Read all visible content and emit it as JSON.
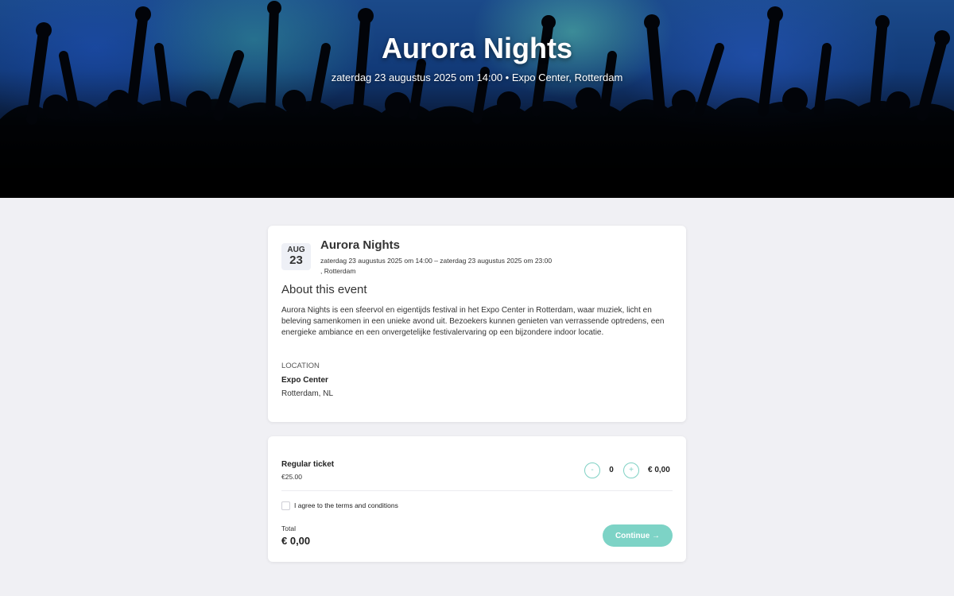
{
  "hero": {
    "title": "Aurora Nights",
    "subtitle": "zaterdag 23 augustus 2025 om 14:00 • Expo Center, Rotterdam"
  },
  "event": {
    "month": "AUG",
    "day": "23",
    "name": "Aurora Nights",
    "dates": "zaterdag 23 augustus 2025 om 14:00 – zaterdag 23 augustus 2025 om 23:00",
    "city_line": ", Rotterdam",
    "about_title": "About this event",
    "about_text": "Aurora Nights is een sfeervol en eigentijds festival in het Expo Center in Rotterdam, waar muziek, licht en beleving samenkomen in een unieke avond uit. Bezoekers kunnen genieten van verrassende optredens, een energieke ambiance en een onvergetelijke festivalervaring op een bijzondere indoor locatie.",
    "location_label": "LOCATION",
    "location_name": "Expo Center",
    "location_city": "Rotterdam, NL"
  },
  "ticket": {
    "name": "Regular ticket",
    "price": "€25.00",
    "minus_label": "-",
    "plus_label": "+",
    "quantity": "0",
    "line_total": "€ 0,00",
    "terms_label": "I agree to the terms and conditions",
    "total_label": "Total",
    "total_value": "€ 0,00",
    "continue_label": "Continue →"
  },
  "colors": {
    "accent": "#7dd3c6",
    "page_background": "#f0f0f4"
  }
}
